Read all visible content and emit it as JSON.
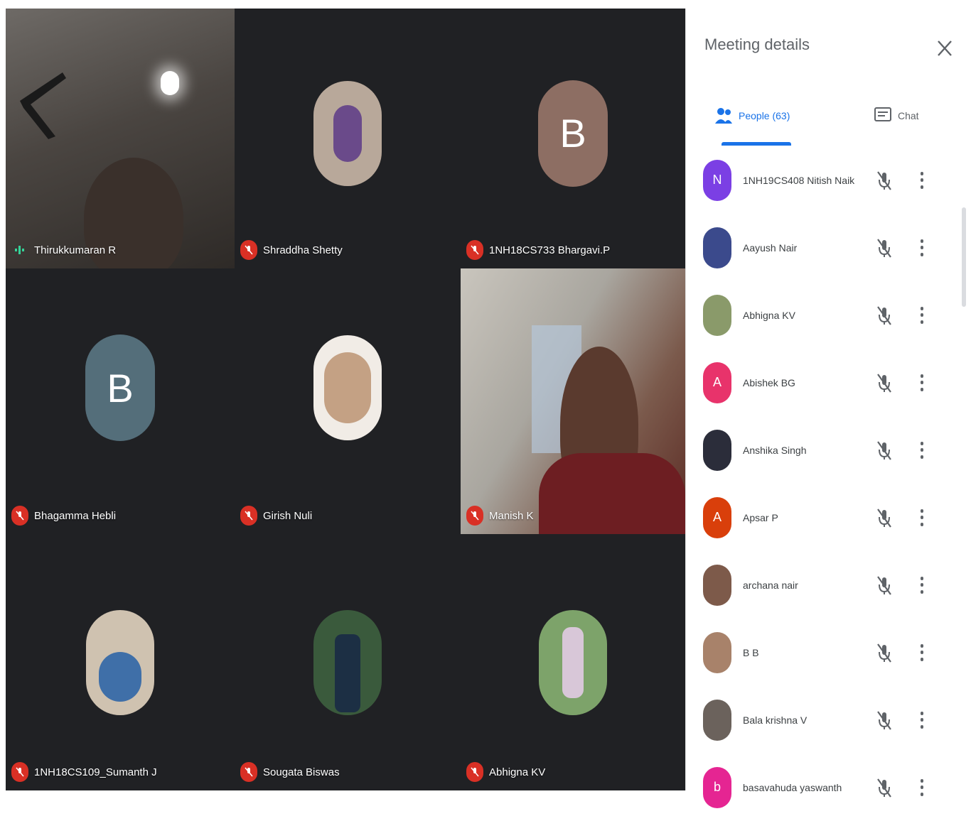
{
  "panel": {
    "title": "Meeting details",
    "close_icon": "close-icon",
    "tabs": [
      {
        "label": "People (63)",
        "icon": "people-icon",
        "active": true
      },
      {
        "label": "Chat",
        "icon": "chat-icon",
        "active": false
      }
    ],
    "people": [
      {
        "name": "1NH19CS408 Nitish Naik",
        "initial": "N",
        "color": "#7b3fe4"
      },
      {
        "name": "Aayush Nair",
        "initial": "",
        "color": "#3b4a8c"
      },
      {
        "name": "Abhigna KV",
        "initial": "",
        "color": "#8a9a6a"
      },
      {
        "name": "Abishek BG",
        "initial": "A",
        "color": "#e8336b"
      },
      {
        "name": "Anshika Singh",
        "initial": "",
        "color": "#2b2d3a"
      },
      {
        "name": "Apsar P",
        "initial": "A",
        "color": "#d93f0b"
      },
      {
        "name": "archana nair",
        "initial": "",
        "color": "#7d5a4a"
      },
      {
        "name": "B B",
        "initial": "",
        "color": "#a8826a"
      },
      {
        "name": "Bala krishna V",
        "initial": "",
        "color": "#6b625c"
      },
      {
        "name": "basavahuda yaswanth",
        "initial": "b",
        "color": "#e52592"
      }
    ]
  },
  "tiles": [
    {
      "name": "Thirukkumaran R",
      "status": "speaking",
      "kind": "video1"
    },
    {
      "name": "Shraddha Shetty",
      "status": "muted",
      "kind": "photo",
      "color": "#b8a89a"
    },
    {
      "name": "1NH18CS733 Bhargavi.P",
      "status": "muted",
      "kind": "letter",
      "letter": "B",
      "color": "#8d6e63"
    },
    {
      "name": "Bhagamma Hebli",
      "status": "muted",
      "kind": "letter",
      "letter": "B",
      "color": "#546e7a"
    },
    {
      "name": "Girish Nuli",
      "status": "muted",
      "kind": "photo",
      "color": "#c4a184"
    },
    {
      "name": "Manish K",
      "status": "muted",
      "kind": "video2"
    },
    {
      "name": "1NH18CS109_Sumanth J",
      "status": "muted",
      "kind": "photo",
      "color": "#cfc2b0"
    },
    {
      "name": "Sougata Biswas",
      "status": "muted",
      "kind": "photo",
      "color": "#3a5a3c"
    },
    {
      "name": "Abhigna KV",
      "status": "muted",
      "kind": "photo",
      "color": "#7da36a"
    }
  ]
}
